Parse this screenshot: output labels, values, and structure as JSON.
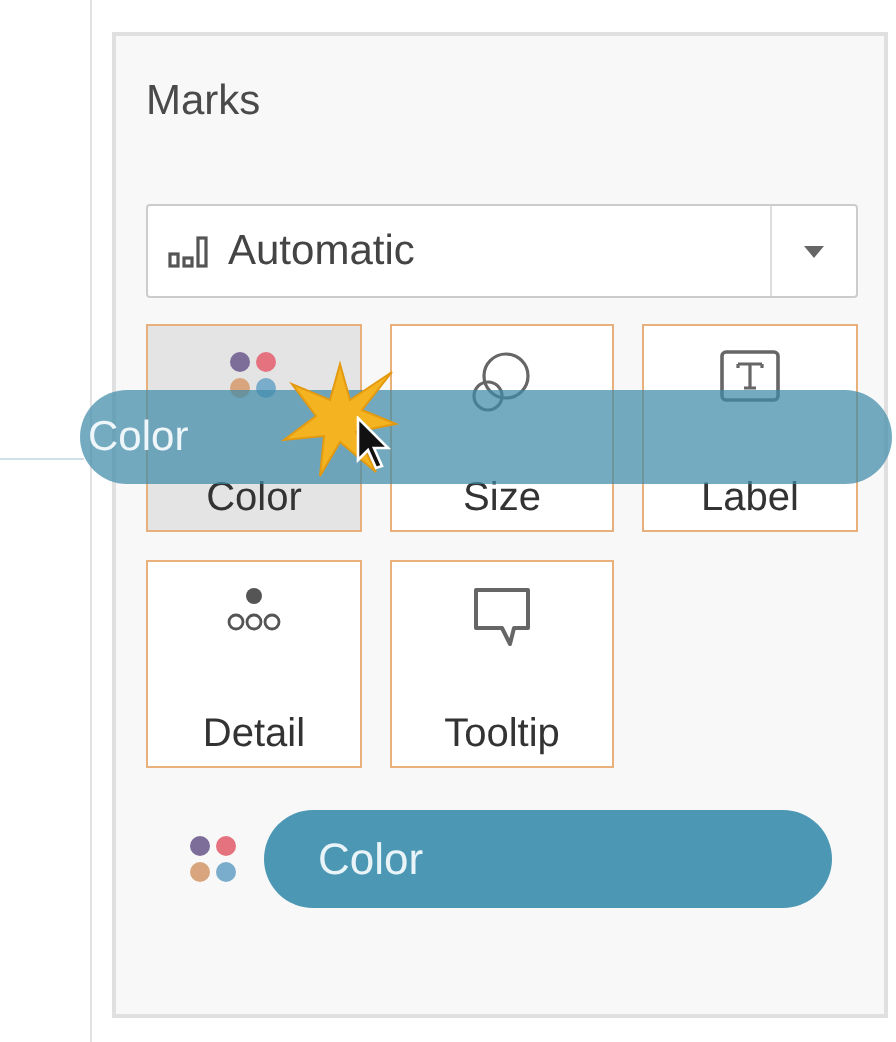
{
  "panel": {
    "title": "Marks"
  },
  "mark_type": {
    "value": "Automatic"
  },
  "cards": [
    {
      "kind": "color",
      "label": "Color",
      "hovered": true
    },
    {
      "kind": "size",
      "label": "Size",
      "hovered": false
    },
    {
      "kind": "text",
      "label": "Label",
      "hovered": false
    },
    {
      "kind": "detail",
      "label": "Detail",
      "hovered": false
    },
    {
      "kind": "tooltip",
      "label": "Tooltip",
      "hovered": false
    }
  ],
  "shelf": [
    {
      "kind": "color",
      "label": "Color"
    }
  ],
  "dragged_pill": {
    "label": "Color"
  }
}
